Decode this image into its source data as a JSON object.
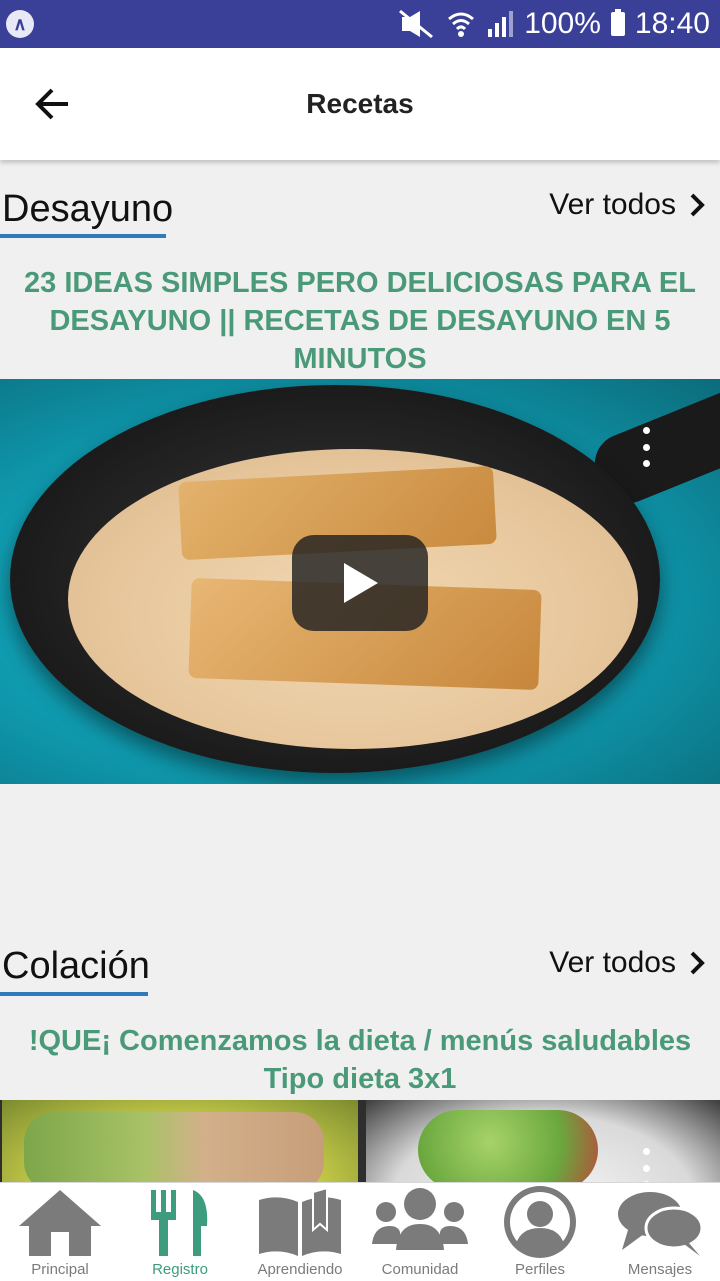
{
  "status_bar": {
    "battery": "100%",
    "time": "18:40"
  },
  "header": {
    "title": "Recetas"
  },
  "sections": [
    {
      "title": "Desayuno",
      "see_all": "Ver todos",
      "video_title": "23 IDEAS SIMPLES PERO DELICIOSAS PARA EL DESAYUNO || RECETAS DE DESAYUNO EN 5 MINUTOS"
    },
    {
      "title": "Colación",
      "see_all": "Ver todos",
      "video_title": "!QUE¡ Comenzamos la dieta / menús saludables Tipo dieta 3x1"
    }
  ],
  "bottom_nav": {
    "items": [
      {
        "label": "Principal",
        "icon": "home-icon"
      },
      {
        "label": "Registro",
        "icon": "fork-knife-icon",
        "active": true
      },
      {
        "label": "Aprendiendo",
        "icon": "book-icon"
      },
      {
        "label": "Comunidad",
        "icon": "people-icon"
      },
      {
        "label": "Perfiles",
        "icon": "profile-icon"
      },
      {
        "label": "Mensajes",
        "icon": "chat-icon"
      }
    ]
  },
  "colors": {
    "status_bar": "#3a3f97",
    "accent_green": "#4a9a7a",
    "underline_blue": "#2f7ab8",
    "nav_active": "#3d9b7e",
    "nav_inactive": "#7b7b7b"
  }
}
